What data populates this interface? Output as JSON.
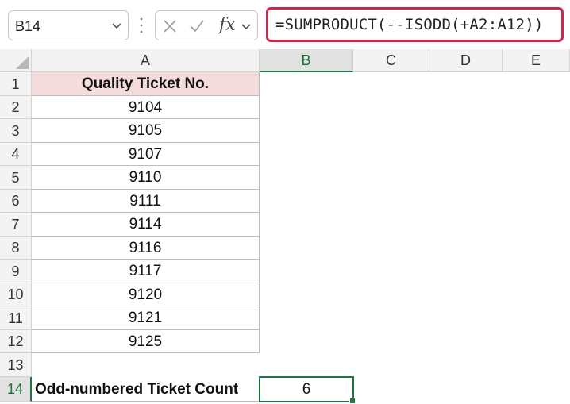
{
  "name_box": {
    "value": "B14"
  },
  "fx_label": "fx",
  "formula": "=SUMPRODUCT(--ISODD(+A2:A12))",
  "columns": [
    "A",
    "B",
    "C",
    "D",
    "E"
  ],
  "rows": [
    "1",
    "2",
    "3",
    "4",
    "5",
    "6",
    "7",
    "8",
    "9",
    "10",
    "11",
    "12",
    "13",
    "14"
  ],
  "cells": {
    "A1": "Quality Ticket No.",
    "A2": "9104",
    "A3": "9105",
    "A4": "9107",
    "A5": "9110",
    "A6": "9111",
    "A7": "9114",
    "A8": "9116",
    "A9": "9117",
    "A10": "9120",
    "A11": "9121",
    "A12": "9125",
    "A14": "Odd-numbered Ticket Count",
    "B14": "6"
  },
  "colors": {
    "highlight_border": "#d0264b",
    "header_fill": "#f5dcdc",
    "selection": "#217346"
  }
}
